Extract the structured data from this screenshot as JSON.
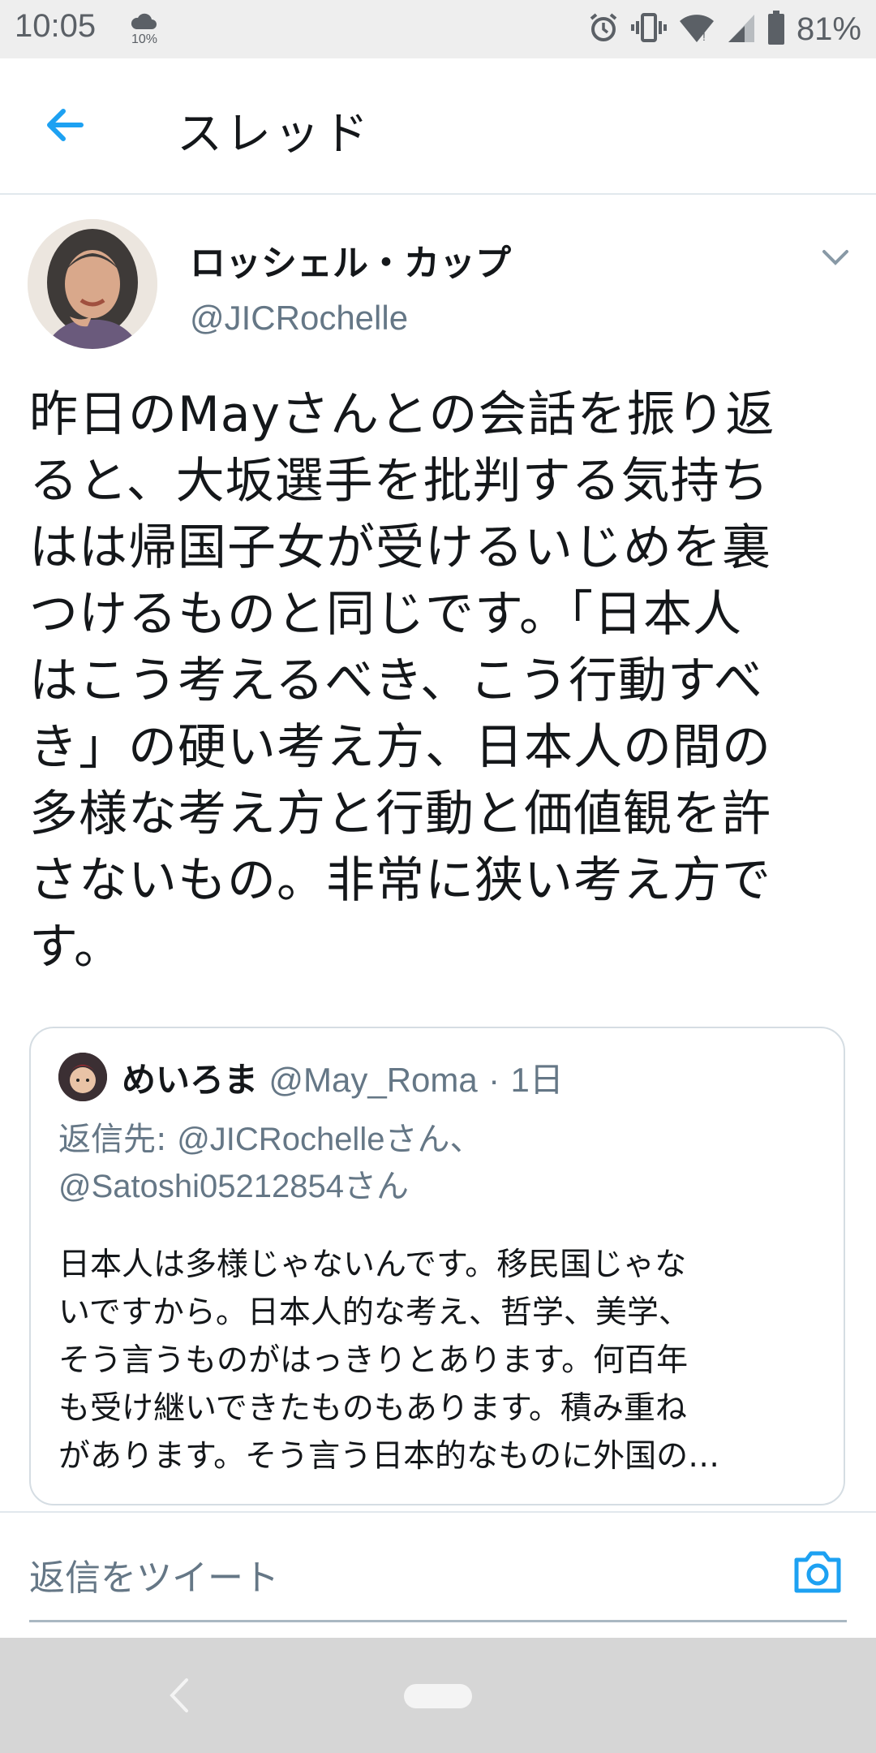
{
  "status_bar": {
    "time": "10:05",
    "rain_chance": "10%",
    "battery": "81%",
    "icons": [
      "cloud-icon",
      "alarm-icon",
      "vibrate-icon",
      "wifi-icon",
      "signal-icon",
      "battery-icon"
    ]
  },
  "header": {
    "title": "スレッド",
    "back_icon": "back-arrow-icon"
  },
  "tweet": {
    "author_name": "ロッシェル・カップ",
    "author_handle": "@JICRochelle",
    "lines": [
      "昨日のMayさんとの会話を振り返",
      "ると、大坂選手を批判する気持ち",
      "はは帰国子女が受けるいじめを裏",
      "つけるものと同じです。「日本人",
      "はこう考えるべき、こう行動すべ",
      "き」の硬い考え方、日本人の間の",
      "多様な考え方と行動と価値観を許",
      "さないもの。非常に狭い考え方で",
      "す。"
    ]
  },
  "quoted_tweet": {
    "author_name": "めいろま",
    "author_handle": "@May_Roma",
    "separator": "·",
    "time_ago": "1日",
    "reply_prefix": "返信先:",
    "reply_to_1": "@JICRochelleさん、",
    "reply_to_2": "@Satoshi05212854さん",
    "lines": [
      "日本人は多様じゃないんです。移民国じゃな",
      "いですから。日本人的な考え、哲学、美学、",
      "そう言うものがはっきりとあります。何百年",
      "も受け継いできたものもあります。積み重ね",
      "があります。そう言う日本的なものに外国の…"
    ]
  },
  "reply_bar": {
    "placeholder": "返信をツイート",
    "camera_icon": "camera-icon"
  },
  "colors": {
    "accent": "#1da1f2",
    "text": "#14171a",
    "secondary": "#657786",
    "border": "#e1e8ed"
  }
}
